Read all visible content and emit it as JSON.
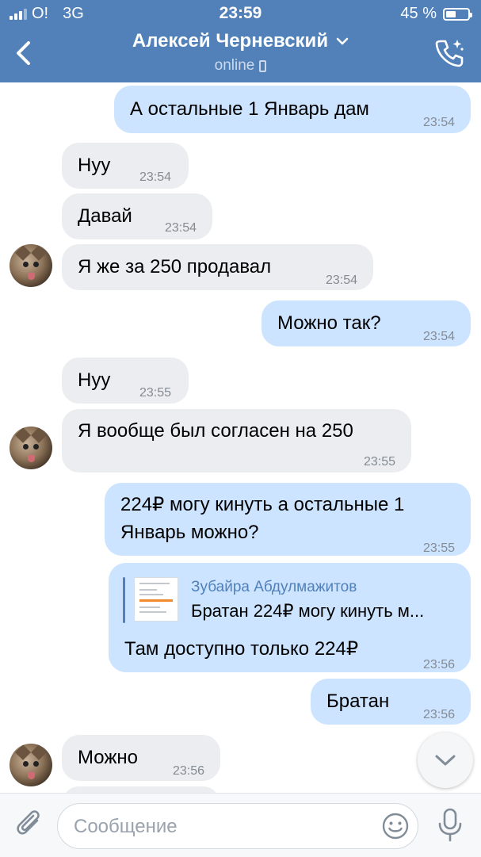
{
  "status_bar": {
    "carrier": "O!",
    "network": "3G",
    "time": "23:59",
    "battery_percent_text": "45 %",
    "battery_level": 0.45
  },
  "header": {
    "name": "Алексей Черневский",
    "status": "online"
  },
  "messages": [
    {
      "dir": "out",
      "text": "А остальные 1 Январь дам",
      "time": "23:54"
    },
    {
      "dir": "in",
      "text": "Нуу",
      "time": "23:54"
    },
    {
      "dir": "in",
      "text": "Давай",
      "time": "23:54"
    },
    {
      "dir": "in",
      "text": "Я же за 250 продавал",
      "time": "23:54",
      "avatar": true
    },
    {
      "dir": "out",
      "text": "Можно так?",
      "time": "23:54"
    },
    {
      "dir": "in",
      "text": "Нуу",
      "time": "23:55"
    },
    {
      "dir": "in",
      "text": "Я вообще был согласен на 250",
      "time": "23:55",
      "avatar": true
    },
    {
      "dir": "out",
      "lines": [
        "224₽ могу кинуть а остальные 1",
        "Январь можно?"
      ],
      "time": "23:55"
    },
    {
      "dir": "out",
      "reply": {
        "author": "Зубайра Абдулмажитов",
        "text": "Братан 224₽ могу кинуть м..."
      },
      "text": "Там доступно только 224₽",
      "time": "23:56"
    },
    {
      "dir": "out",
      "text": "Братан",
      "time": "23:56"
    },
    {
      "dir": "in",
      "text": "Можно",
      "time": "23:56",
      "avatar": true
    }
  ],
  "composer": {
    "placeholder": "Сообщение"
  },
  "colors": {
    "header": "#5181b8",
    "incoming": "#ebedf0",
    "outgoing": "#cce4ff",
    "accent": "#5181b8"
  },
  "icons": [
    "back-arrow-icon",
    "chevron-down-icon",
    "phone-icon",
    "call-icon",
    "scroll-down-chevron-icon",
    "paperclip-icon",
    "emoji-icon",
    "microphone-icon"
  ]
}
